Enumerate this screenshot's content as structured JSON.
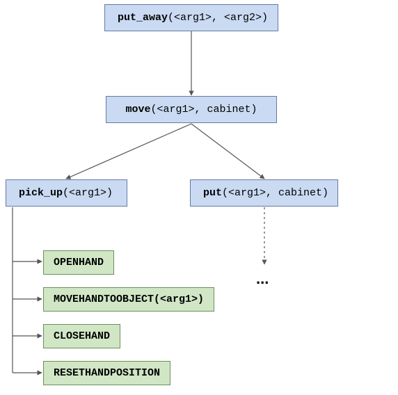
{
  "nodes": {
    "put_away": {
      "fn": "put_away",
      "args": "(<arg1>, <arg2>)"
    },
    "move": {
      "fn": "move",
      "args": "(<arg1>, cabinet)"
    },
    "pick_up": {
      "fn": "pick_up",
      "args": "(<arg1>)"
    },
    "put": {
      "fn": "put",
      "args": "(<arg1>, cabinet)"
    },
    "leaf1": {
      "label": "OPENHAND"
    },
    "leaf2": {
      "label": "MOVEHANDTOOBJECT(<arg1>)"
    },
    "leaf3": {
      "label": "CLOSEHAND"
    },
    "leaf4": {
      "label": "RESETHANDPOSITION"
    }
  },
  "ellipsis": "...",
  "chart_data": {
    "type": "tree",
    "title": "",
    "edges": [
      [
        "put_away",
        "move"
      ],
      [
        "move",
        "pick_up"
      ],
      [
        "move",
        "put"
      ],
      [
        "put",
        "..."
      ],
      [
        "pick_up",
        "OPENHAND"
      ],
      [
        "pick_up",
        "MOVEHANDTOOBJECT(<arg1>)"
      ],
      [
        "pick_up",
        "CLOSEHAND"
      ],
      [
        "pick_up",
        "RESETHANDPOSITION"
      ]
    ],
    "nodes": [
      {
        "id": "put_away",
        "label": "put_away(<arg1>, <arg2>)",
        "kind": "task"
      },
      {
        "id": "move",
        "label": "move(<arg1>, cabinet)",
        "kind": "task"
      },
      {
        "id": "pick_up",
        "label": "pick_up(<arg1>)",
        "kind": "task"
      },
      {
        "id": "put",
        "label": "put(<arg1>, cabinet)",
        "kind": "task"
      },
      {
        "id": "OPENHAND",
        "label": "OPENHAND",
        "kind": "primitive"
      },
      {
        "id": "MOVEHANDTOOBJECT(<arg1>)",
        "label": "MOVEHANDTOOBJECT(<arg1>)",
        "kind": "primitive"
      },
      {
        "id": "CLOSEHAND",
        "label": "CLOSEHAND",
        "kind": "primitive"
      },
      {
        "id": "RESETHANDPOSITION",
        "label": "RESETHANDPOSITION",
        "kind": "primitive"
      }
    ]
  }
}
